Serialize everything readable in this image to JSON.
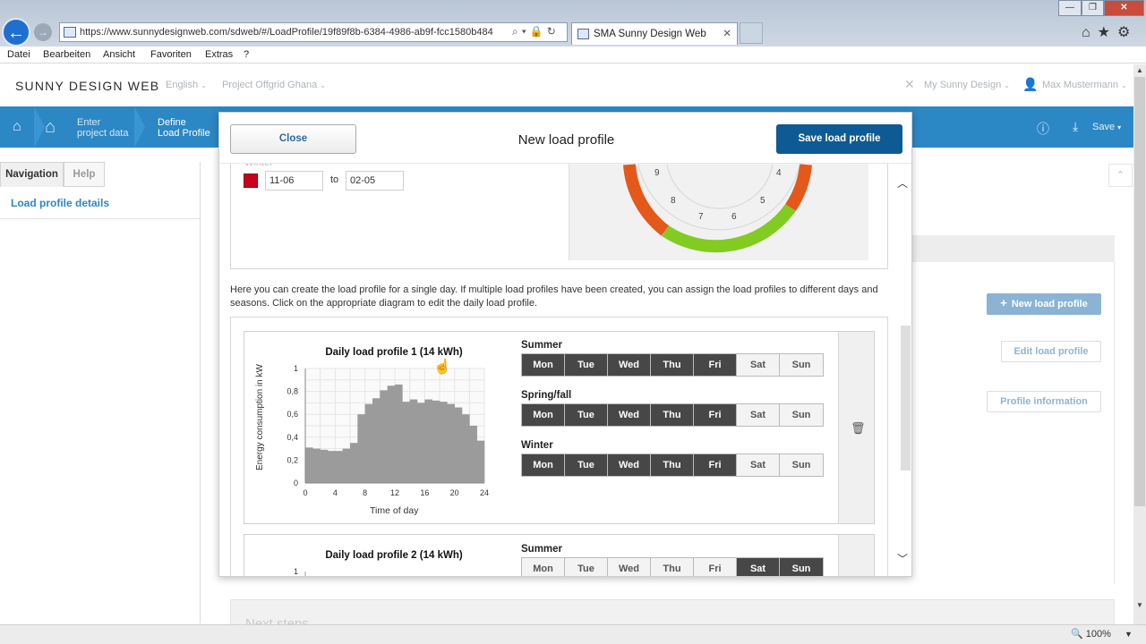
{
  "browser": {
    "url": "https://www.sunnydesignweb.com/sdweb/#/LoadProfile/19f89f8b-6384-4986-ab9f-fcc1580b484",
    "tab_title": "SMA Sunny Design Web",
    "tab_close": "✕",
    "window_buttons": [
      "—",
      "❐",
      "✕"
    ],
    "menu": [
      "Datei",
      "Bearbeiten",
      "Ansicht",
      "Favoriten",
      "Extras",
      "?"
    ],
    "zoom": "100%"
  },
  "header": {
    "brand": "SUNNY DESIGN WEB",
    "language": "English",
    "project": "Project Offgrid Ghana",
    "my_sunny_design": "My Sunny Design",
    "user": "Max Mustermann"
  },
  "stepbar": {
    "step1_line1": "Enter",
    "step1_line2": "project data",
    "step2_line1": "Define",
    "step2_line2": "Load Profile",
    "save": "Save"
  },
  "leftnav": {
    "tabs": [
      "Navigation",
      "Help"
    ],
    "link": "Load profile details"
  },
  "background": {
    "new_load_profile": "New load profile",
    "edit_load_profile": "Edit load profile",
    "profile_information": "Profile information",
    "next_steps": "Next steps"
  },
  "modal": {
    "title": "New load profile",
    "close": "Close",
    "save": "Save load profile",
    "season_label": "Winter",
    "date_from": "11-06",
    "date_to_label": "to",
    "date_to": "02-05",
    "wheel_labels": [
      "9",
      "8",
      "7",
      "6",
      "5",
      "4"
    ],
    "intro": "Here you can create the load profile for a single day. If multiple load profiles have been created, you can assign the load profiles to different days and seasons. Click on the appropriate diagram to edit the daily load profile.",
    "profiles": [
      {
        "title": "Daily load profile 1 (14 kWh)",
        "ylabel": "Energy consumption in kW",
        "xlabel": "Time of day",
        "groups": [
          {
            "label": "Summer",
            "days": [
              {
                "d": "Mon",
                "on": true
              },
              {
                "d": "Tue",
                "on": true
              },
              {
                "d": "Wed",
                "on": true
              },
              {
                "d": "Thu",
                "on": true
              },
              {
                "d": "Fri",
                "on": true
              },
              {
                "d": "Sat",
                "on": false
              },
              {
                "d": "Sun",
                "on": false
              }
            ]
          },
          {
            "label": "Spring/fall",
            "days": [
              {
                "d": "Mon",
                "on": true
              },
              {
                "d": "Tue",
                "on": true
              },
              {
                "d": "Wed",
                "on": true
              },
              {
                "d": "Thu",
                "on": true
              },
              {
                "d": "Fri",
                "on": true
              },
              {
                "d": "Sat",
                "on": false
              },
              {
                "d": "Sun",
                "on": false
              }
            ]
          },
          {
            "label": "Winter",
            "days": [
              {
                "d": "Mon",
                "on": true
              },
              {
                "d": "Tue",
                "on": true
              },
              {
                "d": "Wed",
                "on": true
              },
              {
                "d": "Thu",
                "on": true
              },
              {
                "d": "Fri",
                "on": true
              },
              {
                "d": "Sat",
                "on": false
              },
              {
                "d": "Sun",
                "on": false
              }
            ]
          }
        ]
      },
      {
        "title": "Daily load profile 2 (14 kWh)",
        "groups": [
          {
            "label": "Summer",
            "days": [
              {
                "d": "Mon",
                "on": false
              },
              {
                "d": "Tue",
                "on": false
              },
              {
                "d": "Wed",
                "on": false
              },
              {
                "d": "Thu",
                "on": false
              },
              {
                "d": "Fri",
                "on": false
              },
              {
                "d": "Sat",
                "on": true
              },
              {
                "d": "Sun",
                "on": true
              }
            ]
          }
        ]
      }
    ]
  },
  "chart_data": {
    "type": "bar",
    "title": "Daily load profile 1 (14 kWh)",
    "xlabel": "Time of day",
    "ylabel": "Energy consumption in kW",
    "xlim": [
      0,
      24
    ],
    "ylim": [
      0,
      1
    ],
    "xticks": [
      0,
      4,
      8,
      12,
      16,
      20,
      24
    ],
    "yticks": [
      "0",
      "0,2",
      "0,4",
      "0,6",
      "0,8",
      "1"
    ],
    "x": [
      0,
      1,
      2,
      3,
      4,
      5,
      6,
      7,
      8,
      9,
      10,
      11,
      12,
      13,
      14,
      15,
      16,
      17,
      18,
      19,
      20,
      21,
      22,
      23
    ],
    "values": [
      0.31,
      0.3,
      0.29,
      0.28,
      0.28,
      0.3,
      0.35,
      0.6,
      0.69,
      0.74,
      0.81,
      0.85,
      0.86,
      0.71,
      0.73,
      0.7,
      0.73,
      0.72,
      0.71,
      0.69,
      0.66,
      0.6,
      0.5,
      0.37
    ],
    "grid": true,
    "bar_color": "#9b9b9b"
  },
  "colors": {
    "accent_blue": "#2c87c5",
    "save_button": "#0e5a94",
    "winter_swatch": "#c8001e",
    "wheel_orange": "#e4581a",
    "wheel_green": "#82cc21"
  }
}
